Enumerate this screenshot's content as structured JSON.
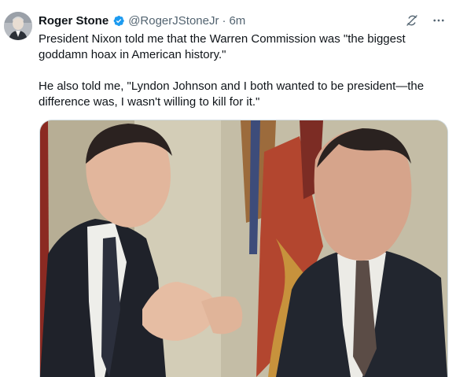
{
  "tweet": {
    "author_name": "Roger Stone",
    "handle": "@RogerJStoneJr",
    "separator": "·",
    "time": "6m",
    "body": "President Nixon told me that the Warren Commission was \"the biggest goddamn hoax in American history.\"\n\nHe also told me, \"Lyndon Johnson and I both wanted to be president—the difference was, I wasn't willing to kill for it.\"",
    "verified": true
  },
  "icons": {
    "verified": "verified-badge-icon",
    "grok": "grok-icon",
    "more": "more-icon"
  },
  "colors": {
    "accent": "#1d9bf0",
    "secondary_text": "#536471"
  }
}
